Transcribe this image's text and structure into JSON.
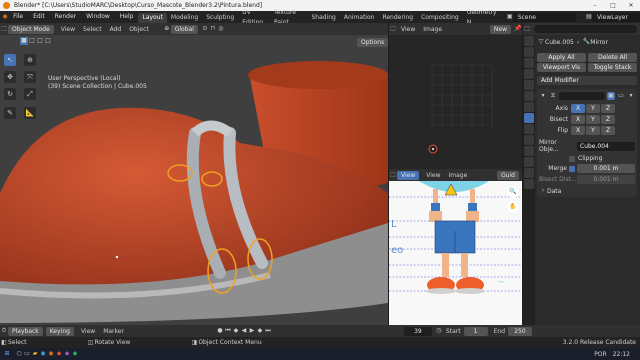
{
  "title_bar": {
    "title": "Blender* [C:\\Users\\StudioMARC\\Desktop\\Curso_Mascote_Blender3.2\\Pintura.blend]",
    "controls": [
      "–",
      "□",
      "✕"
    ]
  },
  "menu": {
    "items": [
      "File",
      "Edit",
      "Render",
      "Window",
      "Help"
    ],
    "workspaces": [
      "Layout",
      "Modeling",
      "Sculpting",
      "UV Editing",
      "Texture Paint",
      "Shading",
      "Animation",
      "Rendering",
      "Compositing",
      "Geometry N"
    ],
    "active_workspace": "Layout",
    "scene_label": "Scene",
    "view_layer_label": "ViewLayer"
  },
  "viewport": {
    "mode": "Object Mode",
    "menus": [
      "View",
      "Select",
      "Add",
      "Object"
    ],
    "transform_orientation": "Global",
    "options_label": "Options",
    "overlay_line1": "User Perspective (Local)",
    "overlay_line2": "(39) Scene Collection | Cube.005"
  },
  "outliner": {
    "menus": [
      "View",
      "Image"
    ],
    "new_label": "New"
  },
  "image_editor": {
    "menus": [
      "View",
      "View",
      "Image"
    ],
    "guide_label": "Guid"
  },
  "properties": {
    "object_name": "Cube.005",
    "modifier_name": "Mirror",
    "apply_all": "Apply All",
    "delete_all": "Delete All",
    "viewport_vis": "Viewport Vis",
    "toggle_stack": "Toggle Stack",
    "add_modifier": "Add Modifier",
    "axis_label": "Axis",
    "bisect_label": "Bisect",
    "flip_label": "Flip",
    "axes": [
      "X",
      "Y",
      "Z"
    ],
    "mirror_object_label": "Mirror Obje...",
    "mirror_object_value": "Cube.004",
    "clipping_label": "Clipping",
    "merge_label": "Merge",
    "merge_value": "0.001 m",
    "bisect_dist_label": "Bisect Dist...",
    "bisect_dist_value": "0.001 m",
    "data_label": "Data"
  },
  "timeline": {
    "playback_label": "Playback",
    "keying_label": "Keying",
    "menus": [
      "View",
      "Marker"
    ],
    "current_frame": "39",
    "start_label": "Start",
    "start_value": "1",
    "end_label": "End",
    "end_value": "250"
  },
  "status_bar": {
    "select": "Select",
    "rotate_view": "Rotate View",
    "object_context_menu": "Object Context Menu",
    "version": "3.2.0 Release Candidate"
  },
  "taskbar": {
    "time": "22:12",
    "language": "POR"
  },
  "colors": {
    "accent": "#4772b3",
    "selection_outline": "#f0a020",
    "shoe_body": "#c24a2a",
    "strap": "#a9aeb4"
  }
}
